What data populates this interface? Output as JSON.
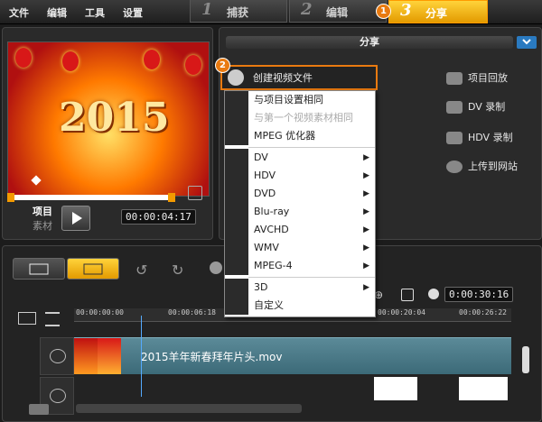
{
  "menu": {
    "file": "文件",
    "edit": "编辑",
    "tools": "工具",
    "settings": "设置"
  },
  "steps": [
    {
      "num": "1",
      "label": "捕获"
    },
    {
      "num": "2",
      "label": "编辑"
    },
    {
      "num": "3",
      "label": "分享"
    }
  ],
  "callouts": {
    "one": "1",
    "two": "2"
  },
  "preview": {
    "year_text": "2015",
    "mode_project": "项目",
    "mode_clip": "素材",
    "timecode": "00:00:04:17"
  },
  "share": {
    "header": "分享",
    "create_file": "创建视频文件",
    "options": {
      "project_playback": "项目回放",
      "dv_record": "DV 录制",
      "hdv_record": "HDV 录制",
      "upload_web": "上传到网站"
    }
  },
  "dropdown": {
    "items": [
      {
        "label": "与项目设置相同",
        "submenu": false,
        "disabled": false
      },
      {
        "label": "与第一个视频素材相同",
        "submenu": false,
        "disabled": true
      },
      {
        "label": "MPEG 优化器",
        "submenu": false,
        "disabled": false
      },
      {
        "label": "DV",
        "submenu": true,
        "disabled": false
      },
      {
        "label": "HDV",
        "submenu": true,
        "disabled": false
      },
      {
        "label": "DVD",
        "submenu": true,
        "disabled": false
      },
      {
        "label": "Blu-ray",
        "submenu": true,
        "disabled": false
      },
      {
        "label": "AVCHD",
        "submenu": true,
        "disabled": false
      },
      {
        "label": "WMV",
        "submenu": true,
        "disabled": false
      },
      {
        "label": "MPEG-4",
        "submenu": true,
        "disabled": false
      },
      {
        "label": "3D",
        "submenu": true,
        "disabled": false
      },
      {
        "label": "自定义",
        "submenu": false,
        "disabled": false
      }
    ]
  },
  "timeline": {
    "duration": "0:00:30:16",
    "ruler": [
      "00:00:00:00",
      "00:00:06:18",
      "00:00:20:04",
      "00:00:26:22"
    ],
    "clip_name": "2015羊年新春拜年片头.mov"
  },
  "colors": {
    "accent": "#e97a10",
    "share_tab": "#ffc21a",
    "video_track": "#4e7e8c"
  }
}
